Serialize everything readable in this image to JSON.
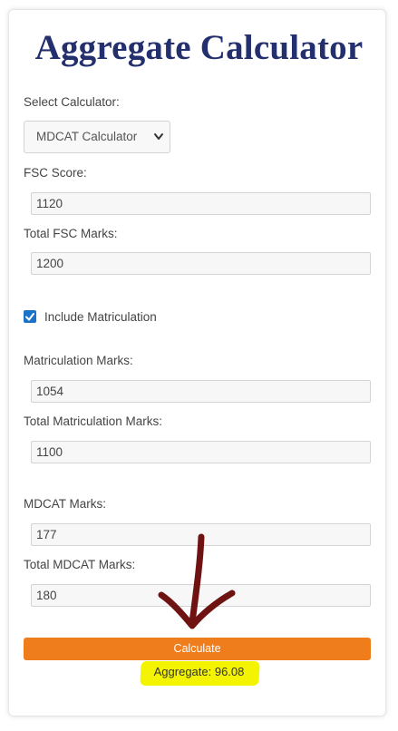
{
  "title": "Aggregate Calculator",
  "select_calculator": {
    "label": "Select Calculator:",
    "value": "MDCAT Calculator"
  },
  "fields": {
    "fsc_score": {
      "label": "FSC Score:",
      "value": "1120"
    },
    "total_fsc": {
      "label": "Total FSC Marks:",
      "value": "1200"
    },
    "matric_marks": {
      "label": "Matriculation Marks:",
      "value": "1054"
    },
    "total_matric": {
      "label": "Total Matriculation Marks:",
      "value": "1100"
    },
    "mdcat_marks": {
      "label": "MDCAT Marks:",
      "value": "177"
    },
    "total_mdcat": {
      "label": "Total MDCAT Marks:",
      "value": "180"
    }
  },
  "include_matric": {
    "label": "Include Matriculation",
    "checked": true
  },
  "calculate_button": "Calculate",
  "result": "Aggregate: 96.08",
  "colors": {
    "title": "#24306e",
    "button": "#f07d1c",
    "highlight": "#f4f400",
    "checkbox": "#1a73c9",
    "arrow": "#6e1212"
  },
  "icons": {
    "dropdown": "chevron-down-icon",
    "checkbox": "check-icon",
    "annotation": "arrow-down-icon"
  }
}
